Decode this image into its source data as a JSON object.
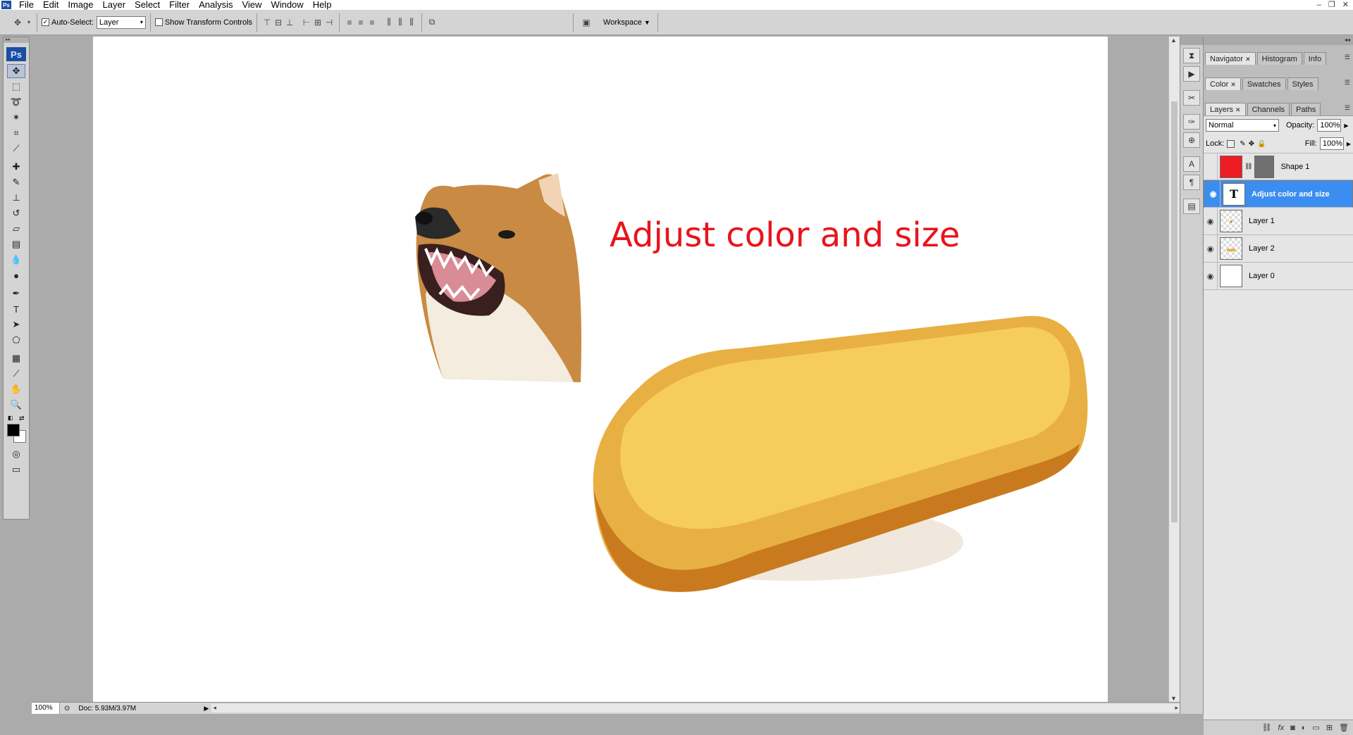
{
  "menubar": {
    "items": [
      "File",
      "Edit",
      "Image",
      "Layer",
      "Select",
      "Filter",
      "Analysis",
      "View",
      "Window",
      "Help"
    ],
    "window_controls": [
      "–",
      "❐",
      "✕"
    ]
  },
  "options": {
    "auto_select_label": "Auto-Select:",
    "auto_select_value": "Layer",
    "show_transform_label": "Show Transform Controls",
    "workspace_label": "Workspace"
  },
  "toolbox": {
    "logo": "Ps"
  },
  "document": {
    "text": "Adjust color and size"
  },
  "status": {
    "zoom": "100%",
    "doc": "Doc: 5.93M/3.97M"
  },
  "panels": {
    "group1": {
      "tabs": [
        "Navigator",
        "Histogram",
        "Info"
      ]
    },
    "group2": {
      "tabs": [
        "Color",
        "Swatches",
        "Styles"
      ]
    },
    "layers": {
      "tabs": [
        "Layers",
        "Channels",
        "Paths"
      ],
      "blend_mode": "Normal",
      "opacity_label": "Opacity:",
      "opacity_value": "100%",
      "lock_label": "Lock:",
      "fill_label": "Fill:",
      "fill_value": "100%",
      "rows": [
        "Shape 1",
        "Adjust color and size",
        "Layer 1",
        "Layer 2",
        "Layer 0"
      ]
    }
  },
  "colors": {
    "accent": "#3b8df0",
    "shape_fill": "#ee1c24",
    "text_color": "#e8141c"
  }
}
